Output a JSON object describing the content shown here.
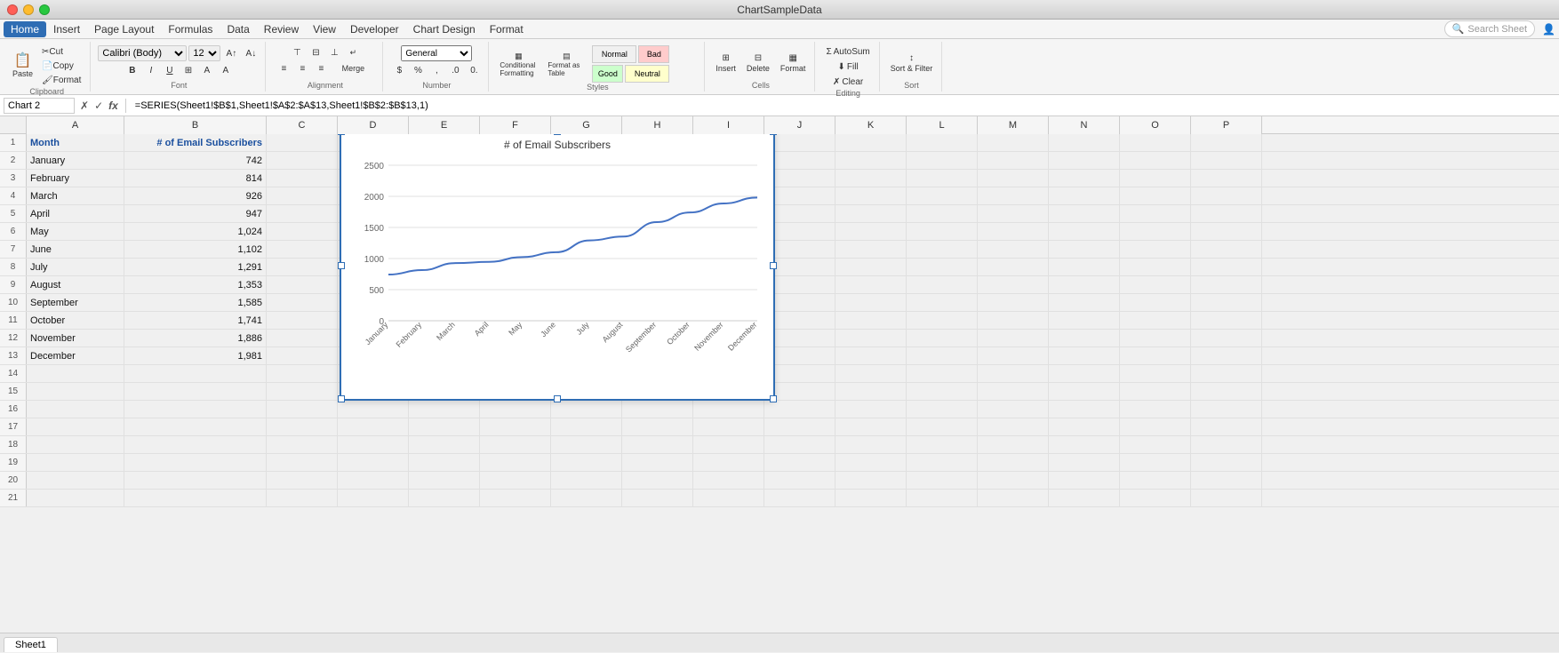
{
  "app": {
    "title": "ChartSampleData",
    "window_buttons": [
      "close",
      "minimize",
      "maximize"
    ]
  },
  "menu": {
    "items": [
      "Home",
      "Insert",
      "Page Layout",
      "Formulas",
      "Data",
      "Review",
      "View",
      "Developer",
      "Chart Design",
      "Format"
    ]
  },
  "toolbar": {
    "paste_label": "Paste",
    "cut_label": "Cut",
    "copy_label": "Copy",
    "format_label": "Format",
    "font": "Calibri (Body)",
    "font_size": "12",
    "bold": "B",
    "italic": "I",
    "underline": "U",
    "wrap_text": "Wrap Text",
    "merge_center": "Merge & Center",
    "general_label": "General",
    "conditional_formatting": "Conditional Formatting",
    "format_as_table": "Format as Table",
    "normal_label": "Normal",
    "bad_label": "Bad",
    "good_label": "Good",
    "neutral_label": "Neutral",
    "insert_label": "Insert",
    "delete_label": "Delete",
    "format_btn_label": "Format",
    "autosum_label": "AutoSum",
    "fill_label": "Fill",
    "clear_label": "Clear",
    "sort_filter_label": "Sort & Filter"
  },
  "formula_bar": {
    "name_box": "Chart 2",
    "formula": "=SERIES(Sheet1!$B$1,Sheet1!$A$2:$A$13,Sheet1!$B$2:$B$13,1)"
  },
  "columns": {
    "headers": [
      "A",
      "B",
      "C",
      "D",
      "E",
      "F",
      "G",
      "H",
      "I",
      "J",
      "K",
      "L",
      "M",
      "N",
      "O",
      "P"
    ]
  },
  "spreadsheet": {
    "rows": [
      {
        "num": 1,
        "a": "Month",
        "b": "# of Email Subscribers",
        "is_header": true
      },
      {
        "num": 2,
        "a": "January",
        "b": "742"
      },
      {
        "num": 3,
        "a": "February",
        "b": "814"
      },
      {
        "num": 4,
        "a": "March",
        "b": "926"
      },
      {
        "num": 5,
        "a": "April",
        "b": "947"
      },
      {
        "num": 6,
        "a": "May",
        "b": "1,024"
      },
      {
        "num": 7,
        "a": "June",
        "b": "1,102"
      },
      {
        "num": 8,
        "a": "July",
        "b": "1,291"
      },
      {
        "num": 9,
        "a": "August",
        "b": "1,353"
      },
      {
        "num": 10,
        "a": "September",
        "b": "1,585"
      },
      {
        "num": 11,
        "a": "October",
        "b": "1,741"
      },
      {
        "num": 12,
        "a": "November",
        "b": "1,886"
      },
      {
        "num": 13,
        "a": "December",
        "b": "1,981"
      },
      {
        "num": 14,
        "a": "",
        "b": ""
      },
      {
        "num": 15,
        "a": "",
        "b": ""
      },
      {
        "num": 16,
        "a": "",
        "b": ""
      },
      {
        "num": 17,
        "a": "",
        "b": ""
      },
      {
        "num": 18,
        "a": "",
        "b": ""
      },
      {
        "num": 19,
        "a": "",
        "b": ""
      },
      {
        "num": 20,
        "a": "",
        "b": ""
      },
      {
        "num": 21,
        "a": "",
        "b": ""
      }
    ]
  },
  "chart": {
    "title": "# of Email Subscribers",
    "y_labels": [
      "0",
      "500",
      "1000",
      "1500",
      "2000",
      "2500"
    ],
    "x_labels": [
      "January",
      "February",
      "March",
      "April",
      "May",
      "June",
      "July",
      "August",
      "September",
      "October",
      "November",
      "December"
    ],
    "data_values": [
      742,
      814,
      926,
      947,
      1024,
      1102,
      1291,
      1353,
      1585,
      1741,
      1886,
      1981
    ],
    "y_max": 2500
  },
  "search": {
    "placeholder": "Search Sheet"
  },
  "sheet_tab": {
    "name": "Sheet1"
  }
}
